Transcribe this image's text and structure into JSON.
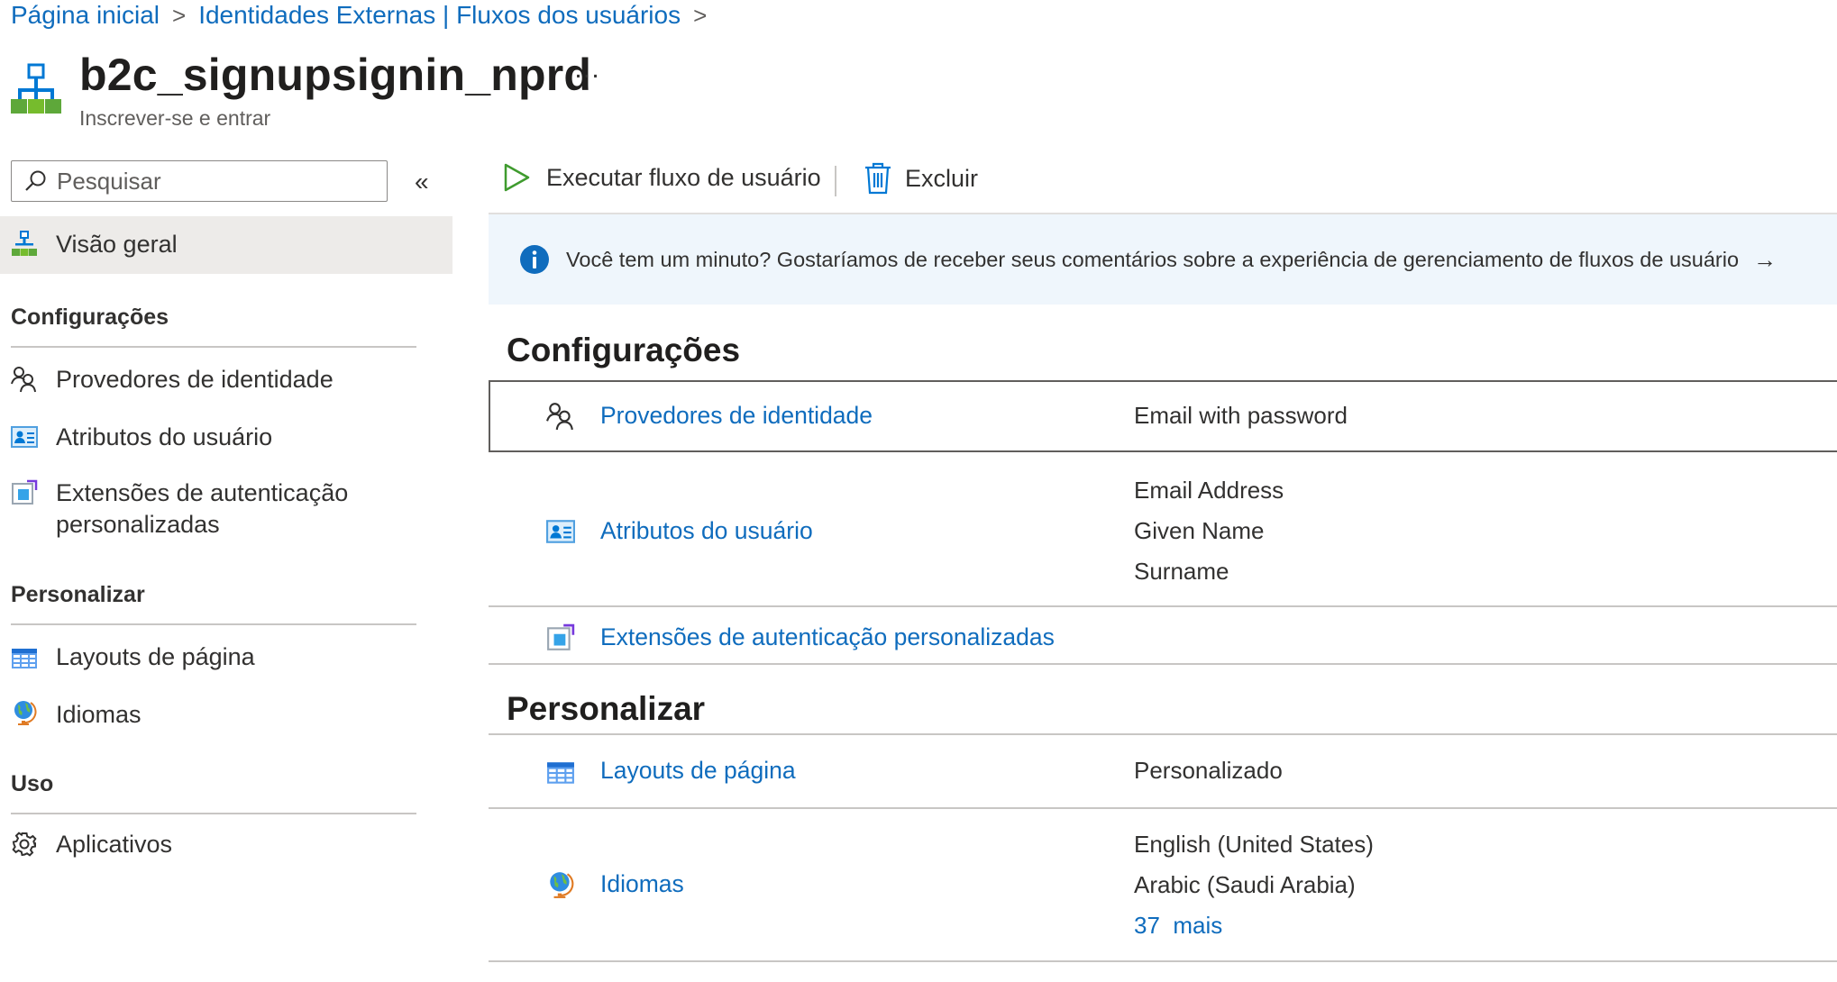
{
  "breadcrumb": {
    "items": [
      "Página inicial",
      "Identidades Externas | Fluxos dos usuários"
    ],
    "separator": ">"
  },
  "header": {
    "title": "b2c_signupsignin_nprd",
    "subtitle": "Inscrever-se e entrar",
    "more_label": "…",
    "icon": "user-flow-icon"
  },
  "sidebar": {
    "search_placeholder": "Pesquisar",
    "collapse_label": "«",
    "overview_label": "Visão geral",
    "groups": {
      "config": "Configurações",
      "customize": "Personalizar",
      "usage": "Uso"
    },
    "items": {
      "identity_providers": "Provedores de identidade",
      "user_attributes": "Atributos do usuário",
      "custom_extensions_line1": "Extensões de autenticação",
      "custom_extensions_line2": "personalizadas",
      "page_layouts": "Layouts de página",
      "languages": "Idiomas",
      "applications": "Aplicativos"
    }
  },
  "toolbar": {
    "run_label": "Executar fluxo de usuário",
    "delete_label": "Excluir"
  },
  "banner": {
    "text": "Você tem um minuto? Gostaríamos de receber seus comentários sobre a experiência de gerenciamento de fluxos de usuário",
    "arrow": "→"
  },
  "sections": {
    "config_title": "Configurações",
    "customize_title": "Personalizar",
    "identity_providers": {
      "label": "Provedores de identidade",
      "value": "Email with password"
    },
    "user_attributes": {
      "label": "Atributos do usuário",
      "values": [
        "Email Address",
        "Given Name",
        "Surname"
      ]
    },
    "custom_extensions": {
      "label": "Extensões de autenticação personalizadas"
    },
    "page_layouts": {
      "label": "Layouts de página",
      "value": "Personalizado"
    },
    "languages": {
      "label": "Idiomas",
      "values": [
        "English (United States)",
        "Arabic (Saudi Arabia)"
      ],
      "more_count": "37",
      "more_label": "mais"
    }
  },
  "colors": {
    "link": "#0f6cbd",
    "banner_bg": "#eff6fc",
    "info_icon": "#0f6cbd",
    "selected_nav": "#edebe9"
  }
}
